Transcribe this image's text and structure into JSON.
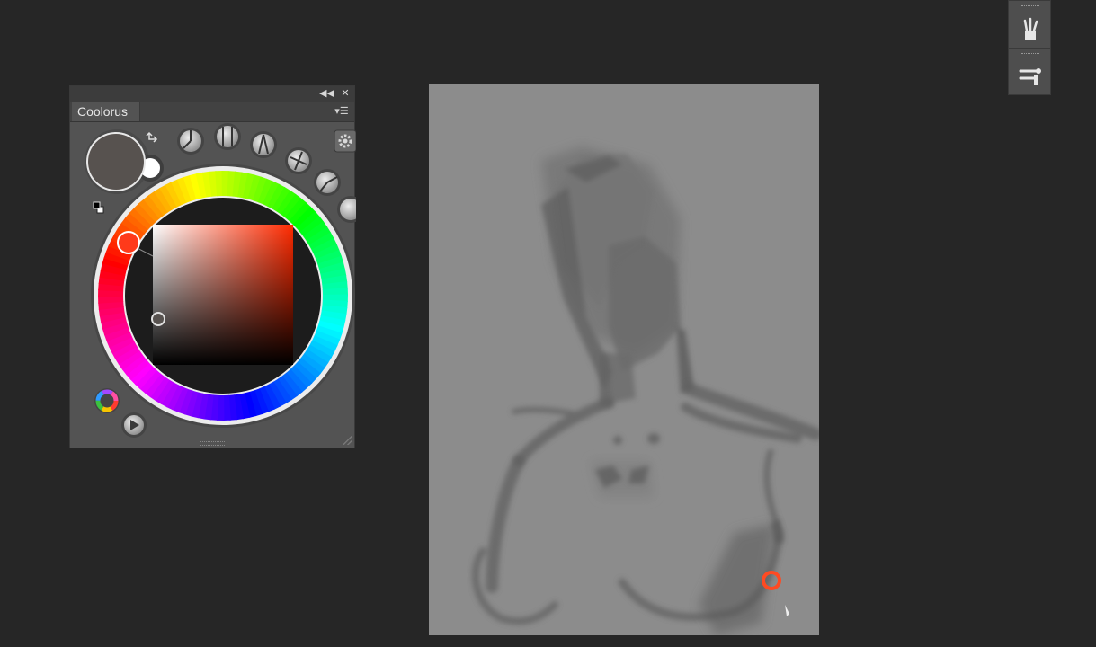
{
  "panel": {
    "title": "Coolorus",
    "collapse_icon": "double-chevron-left-icon",
    "close_icon": "close-icon",
    "menu_icon": "panel-menu-icon"
  },
  "colors": {
    "foreground": "#57524f",
    "background": "#ffffff",
    "selected_hue": "#ff3a1a",
    "brush_cursor": "#ff4a22"
  },
  "tools": {
    "swap_icon": "swap-arrows-icon",
    "default_colors_icon": "default-colors-icon",
    "mode_buttons": [
      "triad-mode-icon",
      "complement-mode-icon",
      "split-mode-icon",
      "tetrad-mode-icon",
      "analog-mode-icon",
      "wheel-mode-icon"
    ],
    "settings_icon": "gear-icon",
    "color_wheel_icon": "color-wheel-icon",
    "play_icon": "play-icon"
  },
  "dock": {
    "brushes_icon": "brushes-icon",
    "brush_settings_icon": "brush-settings-icon"
  }
}
